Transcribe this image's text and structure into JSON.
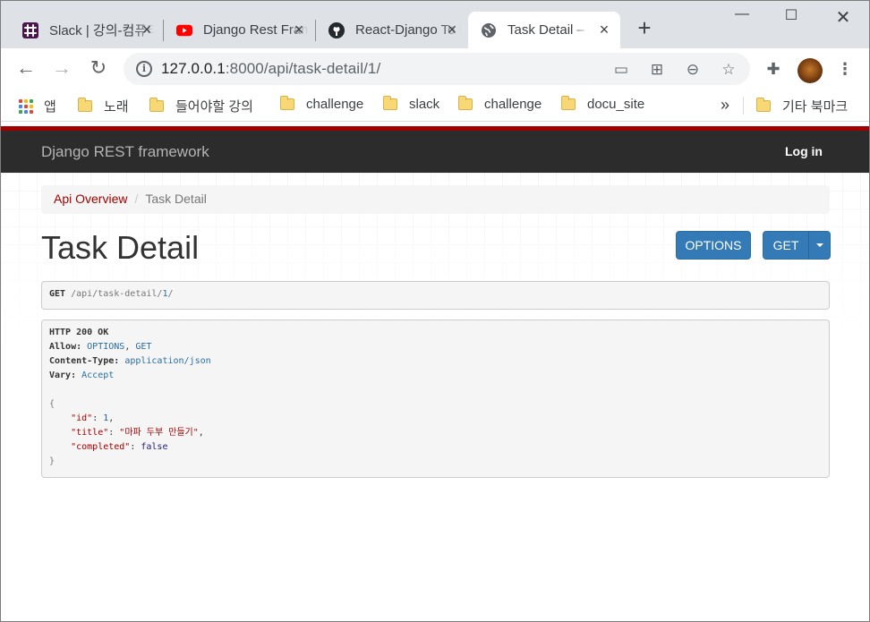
{
  "browser": {
    "tabs": [
      {
        "title": "Slack | 강의-컴퓨터비전",
        "favicon": "slack-icon"
      },
      {
        "title": "Django Rest Framework",
        "favicon": "youtube-icon"
      },
      {
        "title": "React-Django To Do",
        "favicon": "github-icon"
      },
      {
        "title": "Task Detail – Django",
        "favicon": "globe-icon",
        "active": true
      }
    ],
    "url_host": "127.0.0.1",
    "url_rest": ":8000/api/task-detail/1/",
    "bookmarks": {
      "apps_label": "앱",
      "items": [
        "노래",
        "들어야할 강의",
        "challenge",
        "slack",
        "challenge",
        "docu_site"
      ],
      "more": "»",
      "other": "기타 북마크"
    }
  },
  "drf": {
    "brand": "Django REST framework",
    "login": "Log in",
    "breadcrumb": {
      "link": "Api Overview",
      "sep": "/",
      "current": "Task Detail"
    },
    "title": "Task Detail",
    "buttons": {
      "options": "OPTIONS",
      "get": "GET"
    },
    "request": {
      "method": "GET",
      "path_prefix": " /api/task-detail/",
      "path_id": "1",
      "path_suffix": "/"
    },
    "response": {
      "status": "HTTP 200 OK",
      "allow_key": "Allow:",
      "allow_val1": "OPTIONS",
      "allow_val2": "GET",
      "ctype_key": "Content-Type:",
      "ctype_val": "application/json",
      "vary_key": "Vary:",
      "vary_val": "Accept",
      "json": {
        "open": "{",
        "id_key": "\"id\"",
        "id_val": "1",
        "title_key": "\"title\"",
        "title_val": "\"마파 두부 만들기\"",
        "completed_key": "\"completed\"",
        "completed_val": "false",
        "close": "}"
      }
    }
  }
}
